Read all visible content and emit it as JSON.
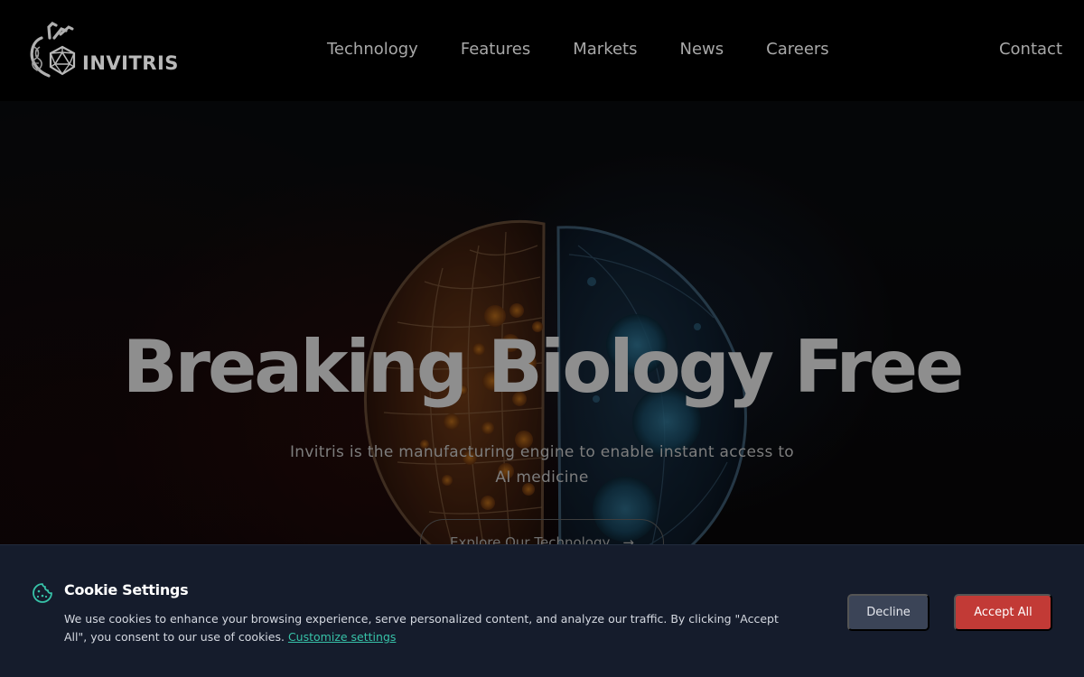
{
  "brand": {
    "name": "INVITRIS",
    "logo_icon": "heart-dna-icosahedron-icon"
  },
  "nav": {
    "items": [
      {
        "label": "Technology"
      },
      {
        "label": "Features"
      },
      {
        "label": "Markets"
      },
      {
        "label": "News"
      },
      {
        "label": "Careers"
      }
    ],
    "contact_label": "Contact"
  },
  "hero": {
    "title": "Breaking Biology Free",
    "subtitle": "Invitris is the manufacturing engine to enable instant access to AI medicine",
    "cta_label": "Explore Our Technology",
    "cta_icon": "arrow-right-icon"
  },
  "cookie_banner": {
    "icon": "cookie-icon",
    "title": "Cookie Settings",
    "text": "We use cookies to enhance your browsing experience, serve personalized content, and analyze our traffic. By clicking \"Accept All\", you consent to our use of cookies.",
    "link_label": "Customize settings",
    "decline_label": "Decline",
    "accept_label": "Accept All"
  },
  "colors": {
    "accent_red": "#c23a36",
    "link_teal": "#37c2a8",
    "banner_bg": "#151c2c"
  }
}
